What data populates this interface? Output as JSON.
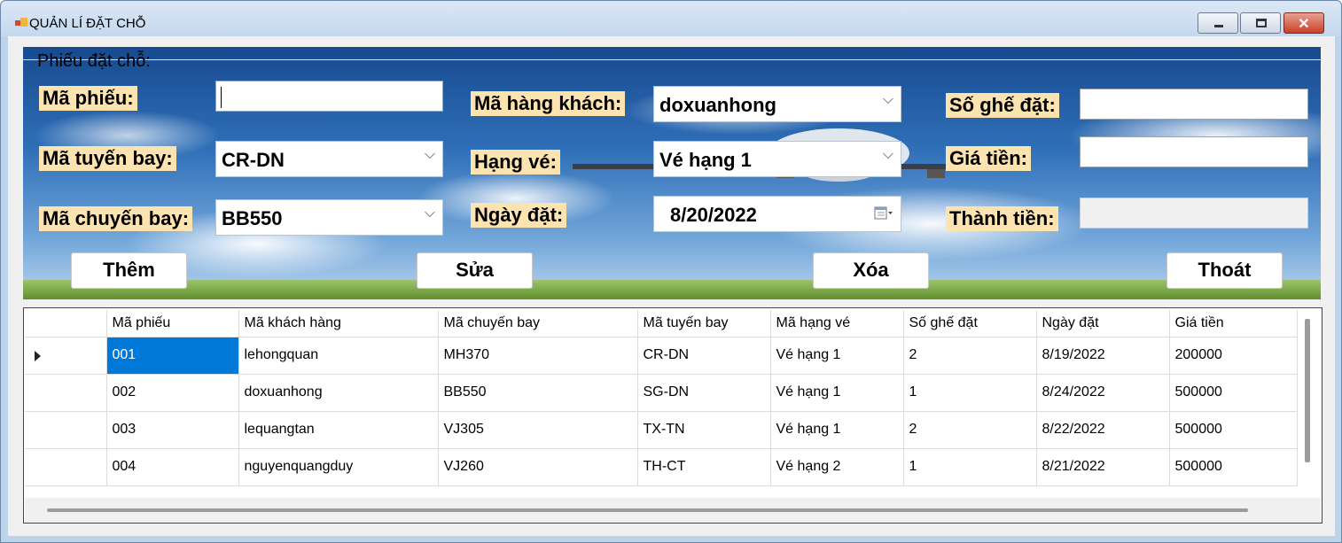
{
  "window": {
    "title": "QUẢN LÍ ĐẶT CHỖ",
    "controls": {
      "minimize_icon": "minimize-icon",
      "maximize_icon": "maximize-icon",
      "close_icon": "close-icon",
      "close_glyph": "✕"
    }
  },
  "form": {
    "group_title": "Phiếu đặt chỗ:",
    "fields": {
      "ma_phieu": {
        "label": "Mã phiếu:",
        "value": ""
      },
      "ma_tuyen_bay": {
        "label": "Mã tuyến bay:",
        "value": "CR-DN"
      },
      "ma_chuyen_bay": {
        "label": "Mã chuyến bay:",
        "value": "BB550"
      },
      "ma_hang_khach": {
        "label": "Mã hàng khách:",
        "value": "doxuanhong"
      },
      "hang_ve": {
        "label": "Hạng vé:",
        "value": "Vé hạng 1"
      },
      "ngay_dat": {
        "label": "Ngày đặt:",
        "value": "8/20/2022"
      },
      "so_ghe_dat": {
        "label": "Số ghế đặt:",
        "value": ""
      },
      "gia_tien": {
        "label": "Giá tiền:",
        "value": ""
      },
      "thanh_tien": {
        "label": "Thành tiền:",
        "value": ""
      }
    },
    "buttons": {
      "them": "Thêm",
      "sua": "Sửa",
      "xoa": "Xóa",
      "thoat": "Thoát"
    }
  },
  "grid": {
    "columns": [
      "Mã phiếu",
      "Mã khách hàng",
      "Mã chuyến bay",
      "Mã tuyến bay",
      "Mã hạng vé",
      "Số ghế đặt",
      "Ngày đặt",
      "Giá tiền"
    ],
    "rows": [
      [
        "001",
        "lehongquan",
        "MH370",
        "CR-DN",
        "Vé hạng 1",
        "2",
        "8/19/2022",
        "200000"
      ],
      [
        "002",
        "doxuanhong",
        "BB550",
        "SG-DN",
        "Vé hạng 1",
        "1",
        "8/24/2022",
        "500000"
      ],
      [
        "003",
        "lequangtan",
        "VJ305",
        "TX-TN",
        "Vé hạng 1",
        "2",
        "8/22/2022",
        "500000"
      ],
      [
        "004",
        "nguyenquangduy",
        "VJ260",
        "TH-CT",
        "Vé hạng 2",
        "1",
        "8/21/2022",
        "500000"
      ]
    ],
    "selected_row": 0,
    "selection_color": "#0078d7"
  },
  "colors": {
    "label_bg": "#fde3b0",
    "sky": "#2f6fb8"
  }
}
